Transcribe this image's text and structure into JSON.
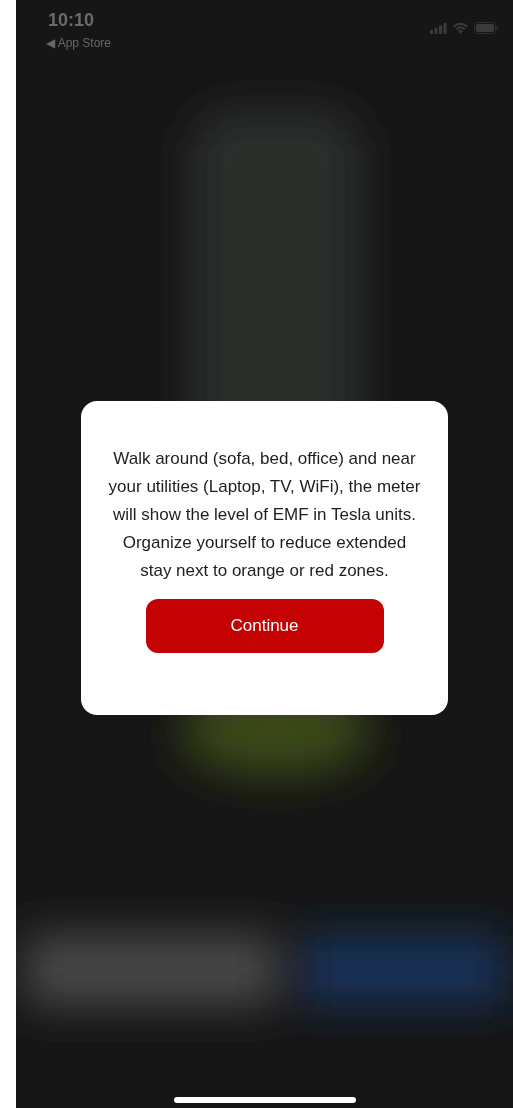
{
  "status_bar": {
    "time": "10:10",
    "back_link": "◀ App Store"
  },
  "dialog": {
    "message": "Walk around (sofa, bed, office) and near your utilities (Laptop, TV, WiFi), the meter will show the level of EMF in Tesla units. Organize yourself to reduce extended stay next to orange or red zones.",
    "button": "Continue"
  }
}
